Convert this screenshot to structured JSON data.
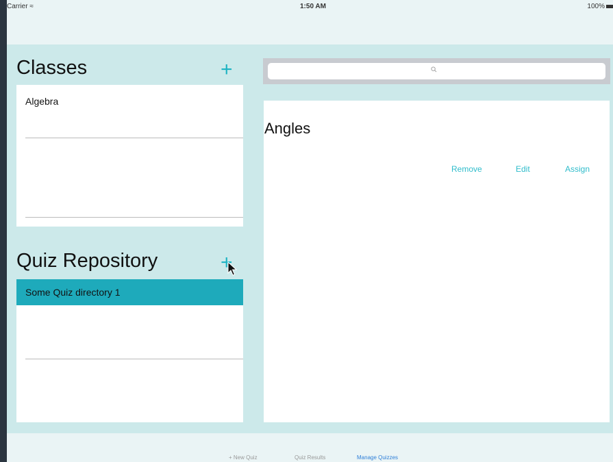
{
  "status_bar": {
    "carrier": "Carrier",
    "time": "1:50 AM",
    "battery": "100%"
  },
  "classes": {
    "title": "Classes",
    "add_label": "+",
    "items": [
      "Algebra"
    ]
  },
  "quiz_repository": {
    "title": "Quiz Repository",
    "add_label": "+",
    "items": [
      "Some Quiz directory 1"
    ]
  },
  "search": {
    "placeholder": ""
  },
  "detail": {
    "title": "Angles",
    "actions": {
      "remove": "Remove",
      "edit": "Edit",
      "assign": "Assign"
    }
  },
  "tabs": {
    "new_quiz": "+ New Quiz",
    "quiz_results": "Quiz Results",
    "manage_quizzes": "Manage Quizzes"
  },
  "colors": {
    "accent": "#1eb3c3",
    "selected_row": "#1eaabb",
    "panel_background": "#cce9ea",
    "active_tab": "#2f7fd8"
  }
}
